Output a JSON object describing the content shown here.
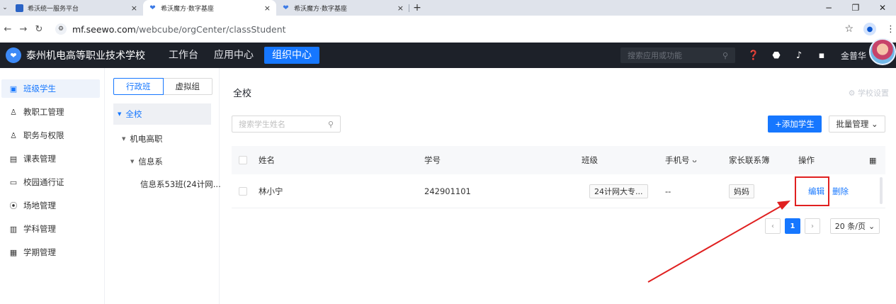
{
  "browser": {
    "tabs": [
      {
        "title": "希沃统一服务平台",
        "active": false
      },
      {
        "title": "希沃魔方·数字基座",
        "active": true
      },
      {
        "title": "希沃魔方·数字基座",
        "active": false
      }
    ],
    "close_glyph": "×",
    "new_tab_glyph": "+",
    "url_host": "mf.seewo.com",
    "url_path": "/webcube/orgCenter/classStudent",
    "window_controls": {
      "minimize": "−",
      "restore": "❐",
      "close": "✕"
    }
  },
  "app": {
    "school_name": "泰州机电高等职业技术学校",
    "nav": [
      "工作台",
      "应用中心",
      "组织中心"
    ],
    "active_nav": "组织中心",
    "search_placeholder": "搜索应用或功能",
    "user_name": "金普华"
  },
  "sidebar": {
    "items": [
      {
        "label": "班级学生",
        "icon": "calendar-icon",
        "glyph": "▣",
        "active": true
      },
      {
        "label": "教职工管理",
        "icon": "user-icon",
        "glyph": "♙",
        "active": false
      },
      {
        "label": "职务与权限",
        "icon": "user-key-icon",
        "glyph": "♙",
        "active": false
      },
      {
        "label": "课表管理",
        "icon": "schedule-icon",
        "glyph": "▤",
        "active": false
      },
      {
        "label": "校园通行证",
        "icon": "card-icon",
        "glyph": "▭",
        "active": false
      },
      {
        "label": "场地管理",
        "icon": "location-icon",
        "glyph": "⦿",
        "active": false
      },
      {
        "label": "学科管理",
        "icon": "book-icon",
        "glyph": "▥",
        "active": false
      },
      {
        "label": "学期管理",
        "icon": "term-icon",
        "glyph": "▦",
        "active": false
      }
    ]
  },
  "tree": {
    "segments": [
      "行政班",
      "虚拟组"
    ],
    "nodes": {
      "root": "全校",
      "level1": "机电高职",
      "level2": "信息系",
      "level3": "信息系53班(24计网..."
    }
  },
  "main": {
    "title": "全校",
    "school_settings": "学校设置",
    "search_placeholder": "搜索学生姓名",
    "add_button": "+添加学生",
    "batch_button": "批量管理",
    "columns": {
      "name": "姓名",
      "student_id": "学号",
      "class": "班级",
      "phone": "手机号",
      "parent": "家长联系簿",
      "action": "操作"
    },
    "rows": [
      {
        "name": "林小宁",
        "student_id": "242901101",
        "class": "24计网大专...",
        "phone": "--",
        "parent": "妈妈",
        "edit": "编辑",
        "delete": "删除"
      }
    ],
    "pagination": {
      "current_page": "1",
      "page_size": "20 条/页"
    }
  },
  "colors": {
    "accent": "#1677ff",
    "header_bg": "#1d2129",
    "annotation": "#e02020"
  }
}
